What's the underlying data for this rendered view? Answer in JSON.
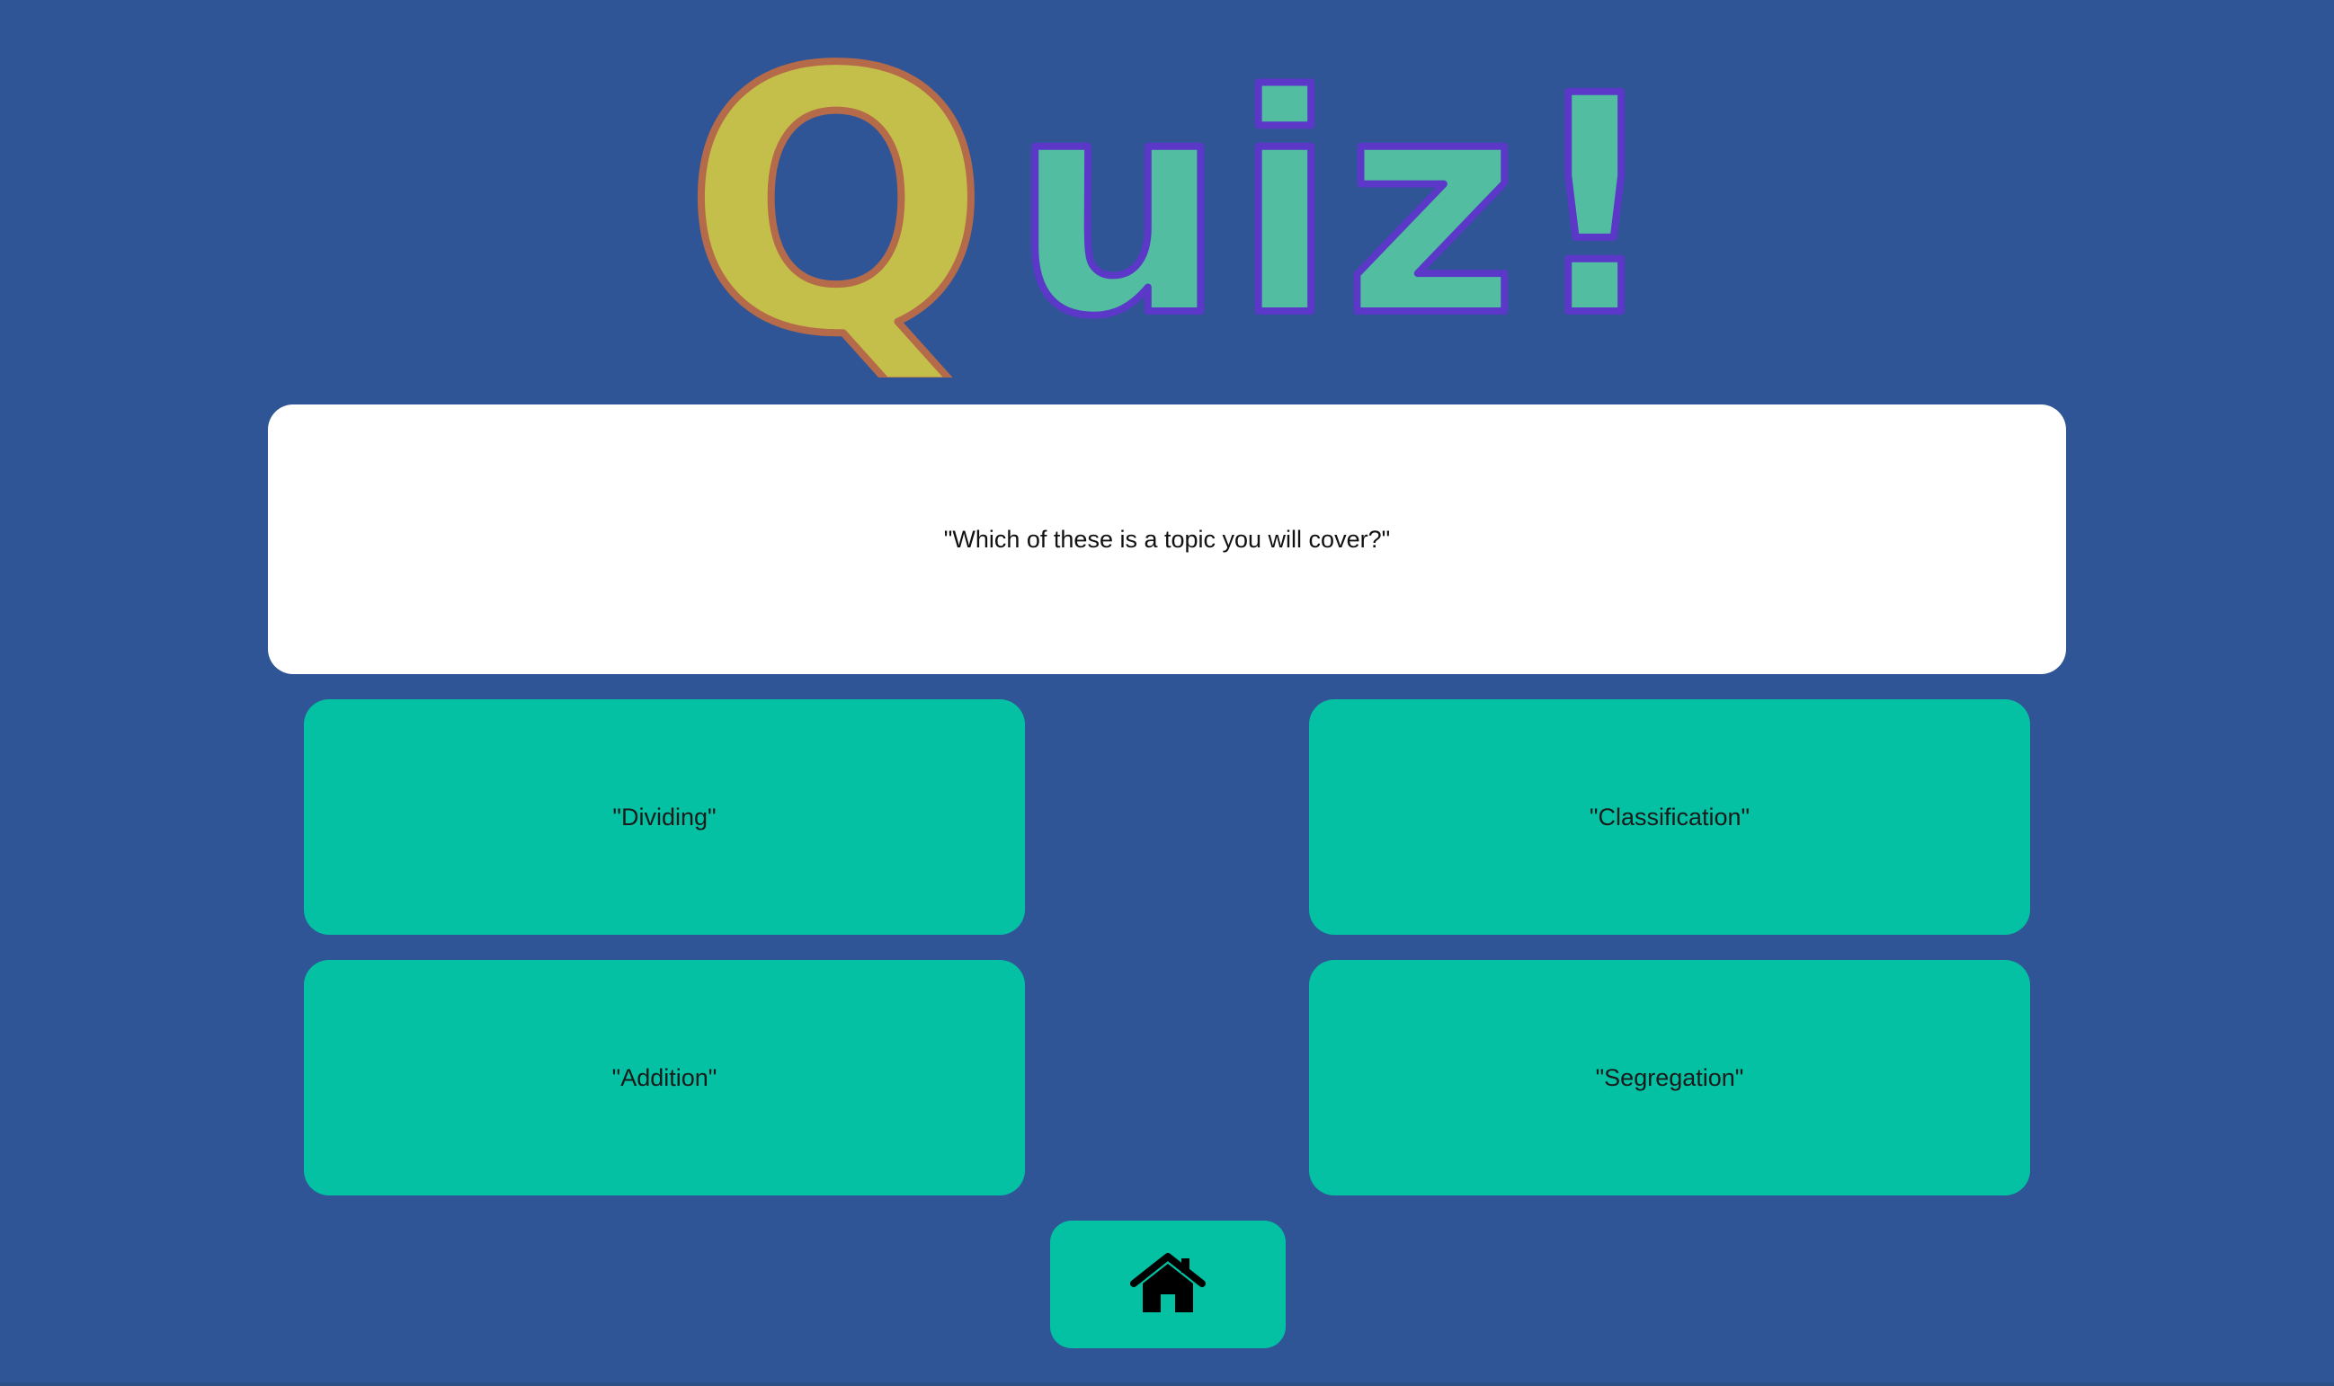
{
  "logo": {
    "first_letter": "Q",
    "rest_letters": "uiz!",
    "first_letter_color": "#c4bf4b",
    "first_letter_outline": "#b56a4a",
    "rest_letters_color": "#52bda0",
    "rest_letters_outline": "#5b38c7"
  },
  "question": {
    "text": "\"Which of these is a topic you will cover?\""
  },
  "answers": [
    {
      "label": "\"Dividing\""
    },
    {
      "label": "\"Classification\""
    },
    {
      "label": "\"Addition\""
    },
    {
      "label": "\"Segregation\""
    }
  ],
  "home_button": {
    "icon": "home-icon"
  },
  "colors": {
    "background": "#2f5596",
    "card": "#ffffff",
    "accent": "#05c1a3"
  }
}
